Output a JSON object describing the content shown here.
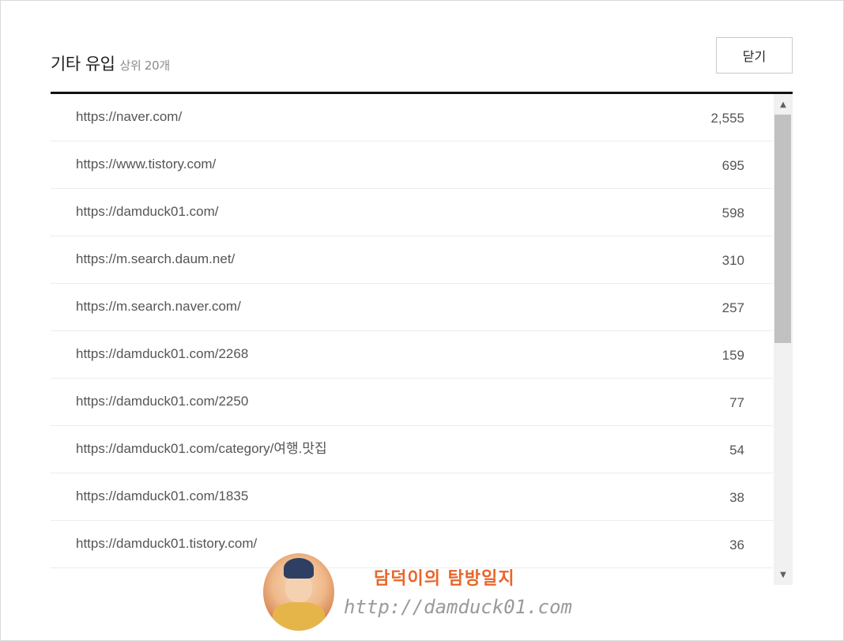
{
  "header": {
    "title": "기타 유입",
    "subtitle": "상위 20개",
    "close_label": "닫기"
  },
  "rows": [
    {
      "url": "https://naver.com/",
      "count": "2,555"
    },
    {
      "url": "https://www.tistory.com/",
      "count": "695"
    },
    {
      "url": "https://damduck01.com/",
      "count": "598"
    },
    {
      "url": "https://m.search.daum.net/",
      "count": "310"
    },
    {
      "url": "https://m.search.naver.com/",
      "count": "257"
    },
    {
      "url": "https://damduck01.com/2268",
      "count": "159"
    },
    {
      "url": "https://damduck01.com/2250",
      "count": "77"
    },
    {
      "url": "https://damduck01.com/category/여행.맛집",
      "count": "54"
    },
    {
      "url": "https://damduck01.com/1835",
      "count": "38"
    },
    {
      "url": "https://damduck01.tistory.com/",
      "count": "36"
    }
  ],
  "watermark": {
    "title": "담덕이의 탐방일지",
    "url": "http://damduck01.com"
  }
}
